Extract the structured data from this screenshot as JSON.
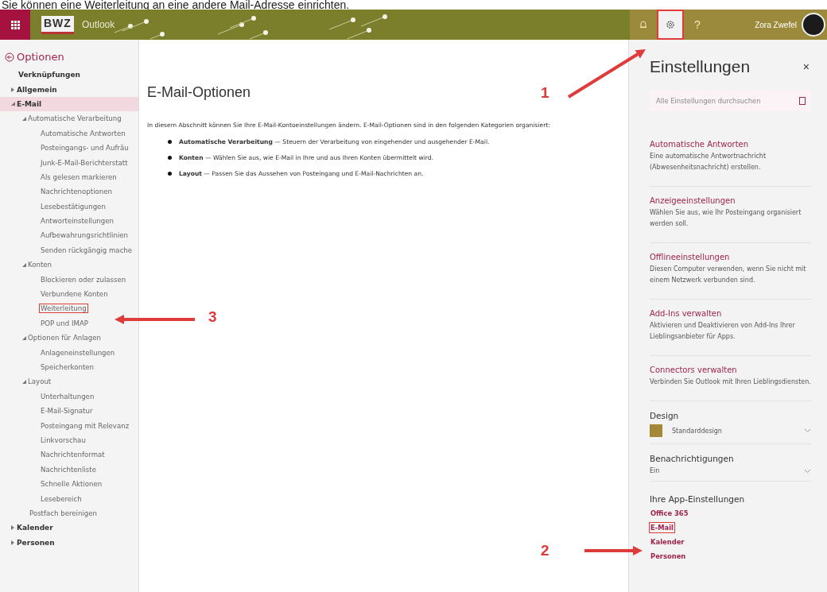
{
  "caption": "Sie können eine Weiterleitung an eine andere Mail-Adresse einrichten.",
  "header": {
    "logo": "BWZ",
    "app": "Outlook",
    "help": "?",
    "user": "Zora Zwefel",
    "settings_boxed": true
  },
  "nav": {
    "title": "Optionen",
    "items": [
      {
        "label": "Verknüpfungen",
        "kind": "heading",
        "selected": false,
        "boxed": false
      },
      {
        "label": "Allgemein",
        "kind": "toggle",
        "expanded": false,
        "selected": false,
        "boxed": false
      },
      {
        "label": "E-Mail",
        "kind": "toggle",
        "expanded": true,
        "selected": true,
        "boxed": false,
        "children": [
          {
            "label": "Automatische Verarbeitung",
            "kind": "toggle",
            "expanded": true,
            "selected": false,
            "boxed": false,
            "children": [
              {
                "label": "Automatische Antworten",
                "kind": "link",
                "selected": false,
                "boxed": false
              },
              {
                "label": "Posteingangs- und Aufräu",
                "kind": "link",
                "selected": false,
                "boxed": false
              },
              {
                "label": "Junk-E-Mail-Berichterstatt",
                "kind": "link",
                "selected": false,
                "boxed": false
              },
              {
                "label": "Als gelesen markieren",
                "kind": "link",
                "selected": false,
                "boxed": false
              },
              {
                "label": "Nachrichtenoptionen",
                "kind": "link",
                "selected": false,
                "boxed": false
              },
              {
                "label": "Lesebestätigungen",
                "kind": "link",
                "selected": false,
                "boxed": false
              },
              {
                "label": "Antworteinstellungen",
                "kind": "link",
                "selected": false,
                "boxed": false
              },
              {
                "label": "Aufbewahrungsrichtlinien",
                "kind": "link",
                "selected": false,
                "boxed": false
              },
              {
                "label": "Senden rückgängig mache",
                "kind": "link",
                "selected": false,
                "boxed": false
              }
            ]
          },
          {
            "label": "Konten",
            "kind": "toggle",
            "expanded": true,
            "selected": false,
            "boxed": false,
            "children": [
              {
                "label": "Blockieren oder zulassen",
                "kind": "link",
                "selected": false,
                "boxed": false
              },
              {
                "label": "Verbundene Konten",
                "kind": "link",
                "selected": false,
                "boxed": false
              },
              {
                "label": "Weiterleitung",
                "kind": "link",
                "selected": false,
                "boxed": true
              },
              {
                "label": "POP und IMAP",
                "kind": "link",
                "selected": false,
                "boxed": false
              }
            ]
          },
          {
            "label": "Optionen für Anlagen",
            "kind": "toggle",
            "expanded": true,
            "selected": false,
            "boxed": false,
            "children": [
              {
                "label": "Anlageneinstellungen",
                "kind": "link",
                "selected": false,
                "boxed": false
              },
              {
                "label": "Speicherkonten",
                "kind": "link",
                "selected": false,
                "boxed": false
              }
            ]
          },
          {
            "label": "Layout",
            "kind": "toggle",
            "expanded": true,
            "selected": false,
            "boxed": false,
            "children": [
              {
                "label": "Unterhaltungen",
                "kind": "link",
                "selected": false,
                "boxed": false
              },
              {
                "label": "E-Mail-Signatur",
                "kind": "link",
                "selected": false,
                "boxed": false
              },
              {
                "label": "Posteingang mit Relevanz",
                "kind": "link",
                "selected": false,
                "boxed": false
              },
              {
                "label": "Linkvorschau",
                "kind": "link",
                "selected": false,
                "boxed": false
              },
              {
                "label": "Nachrichtenformat",
                "kind": "link",
                "selected": false,
                "boxed": false
              },
              {
                "label": "Nachrichtenliste",
                "kind": "link",
                "selected": false,
                "boxed": false
              },
              {
                "label": "Schnelle Aktionen",
                "kind": "link",
                "selected": false,
                "boxed": false
              },
              {
                "label": "Lesebereich",
                "kind": "link",
                "selected": false,
                "boxed": false
              }
            ]
          },
          {
            "label": "Postfach bereinigen",
            "kind": "plain",
            "selected": false,
            "boxed": false
          }
        ]
      },
      {
        "label": "Kalender",
        "kind": "toggle",
        "expanded": false,
        "selected": false,
        "boxed": false
      },
      {
        "label": "Personen",
        "kind": "toggle",
        "expanded": false,
        "selected": false,
        "boxed": false
      }
    ]
  },
  "main": {
    "title": "E-Mail-Optionen",
    "intro": "In diesem Abschnitt können Sie Ihre E-Mail-Kontoeinstellungen ändern. E-Mail-Optionen sind in den folgenden Kategorien organisiert:",
    "bullets": [
      "**Automatische Verarbeitung** — Steuern der Verarbeitung von eingehender und ausgehender E-Mail.",
      "**Konten** — Wählen Sie aus, wie E-Mail in Ihre und aus Ihren Konten übermittelt wird.",
      "**Layout** — Passen Sie das Aussehen von Posteingang und E-Mail-Nachrichten an."
    ]
  },
  "settings": {
    "title": "Einstellungen",
    "close": "×",
    "search_placeholder": "Alle Einstellungen durchsuchen",
    "sections": [
      {
        "link": "Automatische Antworten",
        "text": "Eine automatische Antwortnachricht (Abwesenheitsnachricht) erstellen."
      },
      {
        "link": "Anzeigeeinstellungen",
        "text": "Wählen Sie aus, wie Ihr Posteingang organisiert werden soll."
      },
      {
        "link": "Offlineeinstellungen",
        "text": "Diesen Computer verwenden, wenn Sie nicht mit einem Netzwerk verbunden sind."
      },
      {
        "link": "Add-Ins verwalten",
        "text": "Aktivieren und Deaktivieren von Add-Ins Ihrer Lieblingsanbieter für Apps."
      },
      {
        "link": "Connectors verwalten",
        "text": "Verbinden Sie Outlook mit Ihren Lieblingsdiensten."
      }
    ],
    "dropdowns": [
      {
        "label": "Design",
        "value": "Standarddesign",
        "color": "#a38838"
      },
      {
        "label": "Benachrichtigungen",
        "value": "Ein"
      }
    ],
    "apps": {
      "title": "Ihre App-Einstellungen",
      "links": [
        {
          "label": "Office 365",
          "boxed": false
        },
        {
          "label": "E-Mail",
          "boxed": true
        },
        {
          "label": "Kalender",
          "boxed": false
        },
        {
          "label": "Personen",
          "boxed": false
        }
      ]
    }
  },
  "annotations": [
    {
      "number": "1"
    },
    {
      "number": "2"
    },
    {
      "number": "3"
    }
  ]
}
